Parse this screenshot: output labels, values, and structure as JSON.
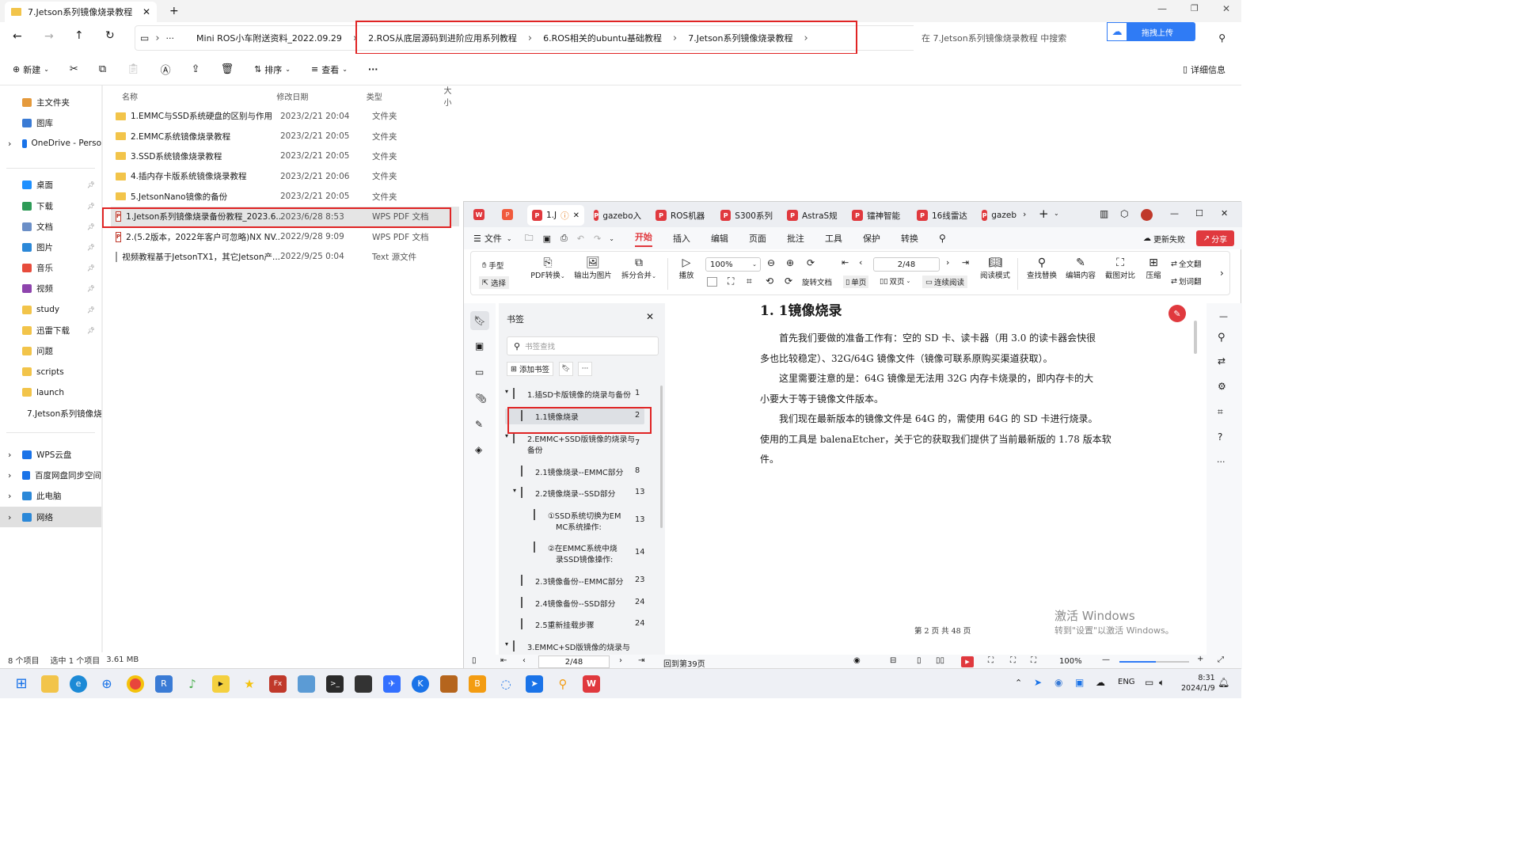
{
  "explorer": {
    "tab_title": "7.Jetson系列镜像烧录教程",
    "breadcrumbs": [
      "Mini ROS小车附送资料_2022.09.29",
      "2.ROS从底层源码到进阶应用系列教程",
      "6.ROS相关的ubuntu基础教程",
      "7.Jetson系列镜像烧录教程"
    ],
    "search_placeholder": "在 7.Jetson系列镜像烧录教程 中搜索",
    "upload_label": "拖拽上传",
    "toolbar": {
      "new": "新建",
      "sort": "排序",
      "view": "查看",
      "details": "详细信息"
    },
    "nav": [
      {
        "label": "主文件夹",
        "icon": "home-icon"
      },
      {
        "label": "图库",
        "icon": "gallery-icon"
      },
      {
        "label": "OneDrive - Perso",
        "icon": "cloud-icon"
      },
      {
        "label": "桌面",
        "icon": "desktop-icon"
      },
      {
        "label": "下载",
        "icon": "download-icon"
      },
      {
        "label": "文档",
        "icon": "document-icon"
      },
      {
        "label": "图片",
        "icon": "image-icon"
      },
      {
        "label": "音乐",
        "icon": "music-icon"
      },
      {
        "label": "视频",
        "icon": "video-icon"
      },
      {
        "label": "study",
        "icon": "folder-icon"
      },
      {
        "label": "迅雷下载",
        "icon": "folder-icon"
      },
      {
        "label": "问题",
        "icon": "folder-icon"
      },
      {
        "label": "scripts",
        "icon": "folder-icon"
      },
      {
        "label": "launch",
        "icon": "folder-icon"
      },
      {
        "label": "7.Jetson系列镜像烧",
        "icon": "folder-icon"
      },
      {
        "label": "WPS云盘",
        "icon": "cloud-icon"
      },
      {
        "label": "百度网盘同步空间",
        "icon": "cloud-icon"
      },
      {
        "label": "此电脑",
        "icon": "pc-icon"
      },
      {
        "label": "网络",
        "icon": "network-icon"
      }
    ],
    "columns": [
      "名称",
      "修改日期",
      "类型",
      "大小"
    ],
    "files": [
      {
        "name": "1.EMMC与SSD系统硬盘的区别与作用",
        "date": "2023/2/21 20:04",
        "type": "文件夹",
        "kind": "folder"
      },
      {
        "name": "2.EMMC系统镜像烧录教程",
        "date": "2023/2/21 20:05",
        "type": "文件夹",
        "kind": "folder"
      },
      {
        "name": "3.SSD系统镜像烧录教程",
        "date": "2023/2/21 20:05",
        "type": "文件夹",
        "kind": "folder"
      },
      {
        "name": "4.插内存卡版系统镜像烧录教程",
        "date": "2023/2/21 20:06",
        "type": "文件夹",
        "kind": "folder"
      },
      {
        "name": "5.JetsonNano镜像的备份",
        "date": "2023/2/21 20:05",
        "type": "文件夹",
        "kind": "folder"
      },
      {
        "name": "1.Jetson系列镜像烧录备份教程_2023.6...",
        "date": "2023/6/28 8:53",
        "type": "WPS PDF 文档",
        "kind": "pdf"
      },
      {
        "name": "2.(5.2版本，2022年客户可忽略)NX NV...",
        "date": "2022/9/28 9:09",
        "type": "WPS PDF 文档",
        "kind": "pdf"
      },
      {
        "name": "视频教程基于JetsonTX1，其它Jetson产...",
        "date": "2022/9/25 0:04",
        "type": "Text 源文件",
        "kind": "text"
      }
    ],
    "status": {
      "count": "8 个项目",
      "selected": "选中 1 个项目",
      "size": "3.61 MB"
    }
  },
  "wps": {
    "tabs": [
      "1.J",
      "gazebo入",
      "ROS机器",
      "S300系列",
      "AstraS规",
      "镭神智能",
      "16线雷达",
      "gazeb"
    ],
    "menu": [
      "文件",
      "开始",
      "插入",
      "编辑",
      "页面",
      "批注",
      "工具",
      "保护",
      "转换"
    ],
    "menu_active": "开始",
    "account": {
      "renew": "更新失败",
      "share": "分享"
    },
    "ribbon": {
      "hand": "手型",
      "select": "选择",
      "pdf_convert": "PDF转换",
      "to_image": "输出为图片",
      "split_merge": "拆分合并",
      "play": "播放",
      "zoom": "100%",
      "page": "2/48",
      "rotate": "旋转文档",
      "single": "单页",
      "double": "双页",
      "continuous": "连续阅读",
      "read_mode": "阅读模式",
      "find_replace": "查找替换",
      "edit": "编辑内容",
      "compare": "截图对比",
      "compress": "压缩",
      "translate": "全文翻",
      "underline": "划词翻"
    },
    "bookmark": {
      "title": "书签",
      "search_placeholder": "书签查找",
      "add": "添加书签",
      "items": [
        {
          "label": "1.插SD卡版镜像的烧录与备份",
          "page": "1"
        },
        {
          "label": "1.1镜像烧录",
          "page": "2"
        },
        {
          "label": "2.EMMC+SSD版镜像的烧录与",
          "label2": "备份",
          "page": "7"
        },
        {
          "label": "2.1镜像烧录--EMMC部分",
          "page": "8"
        },
        {
          "label": "2.2镜像烧录--SSD部分",
          "page": "13"
        },
        {
          "label": "①SSD系统切换为EM",
          "label2": "MC系统操作:",
          "page": "13"
        },
        {
          "label": "②在EMMC系统中烧",
          "label2": "录SSD镜像操作:",
          "page": "14"
        },
        {
          "label": "2.3镜像备份--EMMC部分",
          "page": "23"
        },
        {
          "label": "2.4镜像备份--SSD部分",
          "page": "24"
        },
        {
          "label": "2.5重新挂载步骤",
          "page": "24"
        },
        {
          "label": "3.EMMC+SD版镜像的烧录与",
          "page": ""
        }
      ]
    },
    "doc": {
      "heading": "1. 1镜像烧录",
      "lines": [
        "首先我们要做的准备工作有：空的 SD 卡、读卡器（用 3.0 的读卡器会快很",
        "多也比较稳定）、32G/64G 镜像文件（镜像可联系原购买渠道获取）。",
        "这里需要注意的是：64G 镜像是无法用 32G 内存卡烧录的，即内存卡的大",
        "小要大于等于镜像文件版本。",
        "我们现在最新版本的镜像文件是 64G 的，需使用 64G 的 SD 卡进行烧录。",
        "使用的工具是 balenaEtcher，关于它的获取我们提供了当前最新版的 1.78 版本软",
        "件。"
      ],
      "footer": "第 2 页 共 48 页"
    },
    "watermark": {
      "line1": "激活 Windows",
      "line2": "转到\"设置\"以激活 Windows。"
    },
    "status": {
      "page": "2/48",
      "back": "回到第39页",
      "zoom": "100%"
    }
  },
  "taskbar": {
    "lang": "ENG",
    "time": "8:31",
    "date": "2024/1/9"
  },
  "colors": {
    "accent_red": "#e02424",
    "wps_red": "#e0393e",
    "folder": "#f2c44a",
    "baidu_blue": "#2f7bf5"
  }
}
